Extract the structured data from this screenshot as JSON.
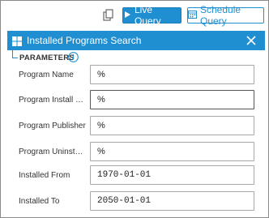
{
  "toolbar": {
    "copy_icon": "copy-icon",
    "live_query_label": "Live Query",
    "schedule_query_label": "Schedule Query"
  },
  "panel": {
    "title": "Installed Programs Search",
    "icon": "windows-logo-icon"
  },
  "parameters": {
    "label": "PARAMETERS",
    "fields": [
      {
        "label": "Program Name",
        "value": "%"
      },
      {
        "label": "Program Install Locat...",
        "value": "%"
      },
      {
        "label": "Program Publisher",
        "value": "%"
      },
      {
        "label": "Program Uninstall Str...",
        "value": "%"
      },
      {
        "label": "Installed From",
        "value": "1970-01-01"
      },
      {
        "label": "Installed To",
        "value": "2050-01-01"
      }
    ]
  },
  "colors": {
    "accent": "#1f8fd1",
    "border": "#a8a8a8"
  }
}
